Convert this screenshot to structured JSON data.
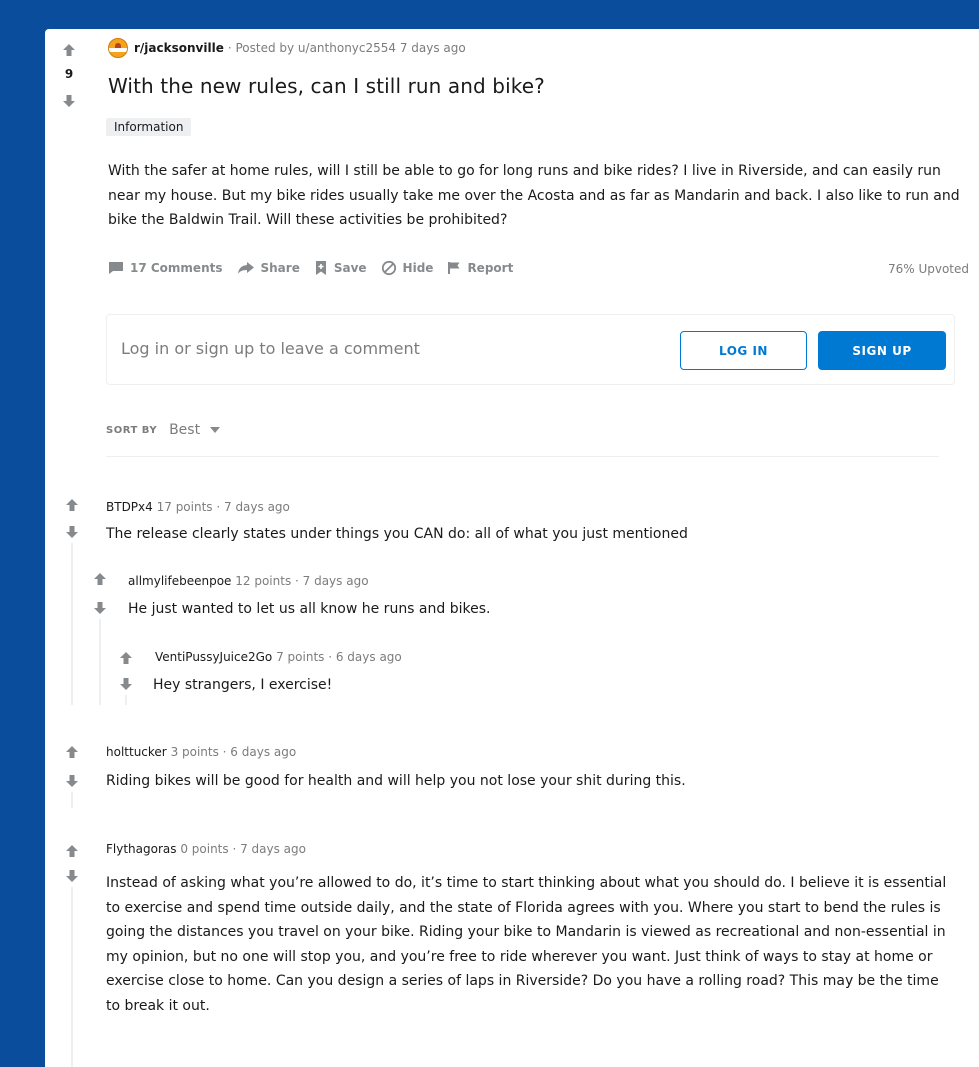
{
  "post": {
    "subreddit": "r/jacksonville",
    "posted_by": "· Posted by u/anthonyc2554 7 days ago",
    "score": "9",
    "title": "With the new rules, can I still run and bike?",
    "flair": "Information",
    "body": "With the safer at home rules, will I still be able to go for long runs and bike rides? I live in Riverside, and can easily run near my house. But my bike rides usually take me over the Acosta and as far as Mandarin and back. I also like to run and bike the Baldwin Trail. Will these activities be prohibited?",
    "actions": {
      "comments": "17 Comments",
      "share": "Share",
      "save": "Save",
      "hide": "Hide",
      "report": "Report"
    },
    "upvoted": "76% Upvoted"
  },
  "login_prompt": {
    "text": "Log in or sign up to leave a comment",
    "login_label": "LOG IN",
    "signup_label": "SIGN UP"
  },
  "sort": {
    "label": "SORT BY",
    "value": "Best"
  },
  "comments": [
    {
      "author": "BTDPx4",
      "meta": "17 points · 7 days ago",
      "body": "The release clearly states under things you CAN do: all of what you just mentioned"
    },
    {
      "author": "allmylifebeenpoe",
      "meta": "12 points · 7 days ago",
      "body": "He just wanted to let us all know he runs and bikes."
    },
    {
      "author": "VentiPussyJuice2Go",
      "meta": "7 points · 6 days ago",
      "body": "Hey strangers, I exercise!"
    },
    {
      "author": "holttucker",
      "meta": "3 points · 6 days ago",
      "body": "Riding bikes will be good for health and will help you not lose your shit during this."
    },
    {
      "author": "Flythagoras",
      "meta": "0 points · 7 days ago",
      "body": "Instead of asking what you’re allowed to do, it’s time to start thinking about what you should do. I believe it is essential to exercise and spend time outside daily, and the state of Florida agrees with you. Where you start to bend the rules is going the distances you travel on your bike. Riding your bike to Mandarin is viewed as recreational and non-essential in my opinion, but no one will stop you, and you’re free to ride wherever you want. Just think of ways to stay at home or exercise close to home. Can you design a series of laps in Riverside? Do you have a rolling road? This may be the time to break it out."
    }
  ],
  "colors": {
    "background": "#0a4d9c",
    "accent": "#0079d3",
    "meta_text": "#7c7c7c",
    "icon_gray": "#878a8c"
  }
}
